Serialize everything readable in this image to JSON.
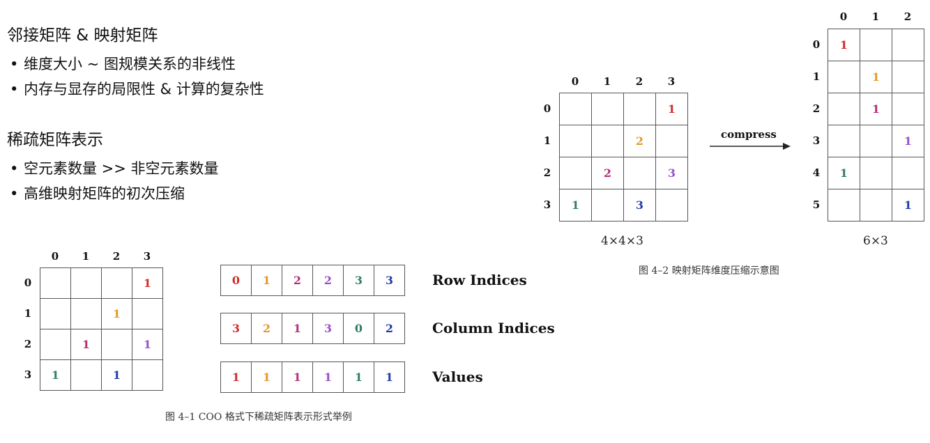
{
  "text": {
    "section1_title": "邻接矩阵 & 映射矩阵",
    "section1_bullets": [
      "维度大小 ~ 图规模关系的非线性",
      "内存与显存的局限性 & 计算的复杂性"
    ],
    "section2_title": "稀疏矩阵表示",
    "section2_bullets": [
      "空元素数量 >> 非空元素数量",
      "高维映射矩阵的初次压缩"
    ],
    "bullet_char": "•"
  },
  "colors": {
    "red": "#d42a2a",
    "orange": "#e39a2a",
    "magenta": "#b0307a",
    "purple": "#9a4fc8",
    "teal": "#2f7d68",
    "blue": "#1f3ca8",
    "border": "#555555"
  },
  "fig1": {
    "col_indices": [
      "0",
      "1",
      "2",
      "3"
    ],
    "row_indices": [
      "0",
      "1",
      "2",
      "3"
    ],
    "cells": [
      [
        "",
        "",
        "",
        "1"
      ],
      [
        "",
        "",
        "1",
        ""
      ],
      [
        "",
        "1",
        "",
        "1"
      ],
      [
        "1",
        "",
        "1",
        ""
      ]
    ],
    "cell_colors": [
      [
        "",
        "",
        "",
        "red"
      ],
      [
        "",
        "",
        "orange",
        ""
      ],
      [
        "",
        "magenta",
        "",
        "purple"
      ],
      [
        "teal",
        "",
        "blue",
        ""
      ]
    ],
    "arrays": [
      {
        "label": "Row Indices",
        "values": [
          "0",
          "1",
          "2",
          "2",
          "3",
          "3"
        ]
      },
      {
        "label": "Column Indices",
        "values": [
          "3",
          "2",
          "1",
          "3",
          "0",
          "2"
        ]
      },
      {
        "label": "Values",
        "values": [
          "1",
          "1",
          "1",
          "1",
          "1",
          "1"
        ]
      }
    ],
    "array_colors": [
      "red",
      "orange",
      "magenta",
      "purple",
      "teal",
      "blue"
    ],
    "caption": "图 4–1  COO 格式下稀疏矩阵表示形式举例"
  },
  "fig2": {
    "left": {
      "col_indices": [
        "0",
        "1",
        "2",
        "3"
      ],
      "row_indices": [
        "0",
        "1",
        "2",
        "3"
      ],
      "cells": [
        [
          "",
          "",
          "",
          "1"
        ],
        [
          "",
          "",
          "2",
          ""
        ],
        [
          "",
          "2",
          "",
          "3"
        ],
        [
          "1",
          "",
          "3",
          ""
        ]
      ],
      "cell_colors": [
        [
          "",
          "",
          "",
          "red"
        ],
        [
          "",
          "",
          "orange",
          ""
        ],
        [
          "",
          "magenta",
          "",
          "purple"
        ],
        [
          "teal",
          "",
          "blue",
          ""
        ]
      ],
      "dim_label": "4×4×3"
    },
    "arrow_label": "compress",
    "right": {
      "col_indices": [
        "0",
        "1",
        "2"
      ],
      "row_indices": [
        "0",
        "1",
        "2",
        "3",
        "4",
        "5"
      ],
      "cells": [
        [
          "1",
          "",
          ""
        ],
        [
          "",
          "1",
          ""
        ],
        [
          "",
          "1",
          ""
        ],
        [
          "",
          "",
          "1"
        ],
        [
          "1",
          "",
          ""
        ],
        [
          "",
          "",
          "1"
        ]
      ],
      "cell_colors": [
        [
          "red",
          "",
          ""
        ],
        [
          "",
          "orange",
          ""
        ],
        [
          "",
          "magenta",
          ""
        ],
        [
          "",
          "",
          "purple"
        ],
        [
          "teal",
          "",
          ""
        ],
        [
          "",
          "",
          "blue"
        ]
      ],
      "dim_label": "6×3"
    },
    "caption": "图 4–2  映射矩阵维度压缩示意图"
  }
}
